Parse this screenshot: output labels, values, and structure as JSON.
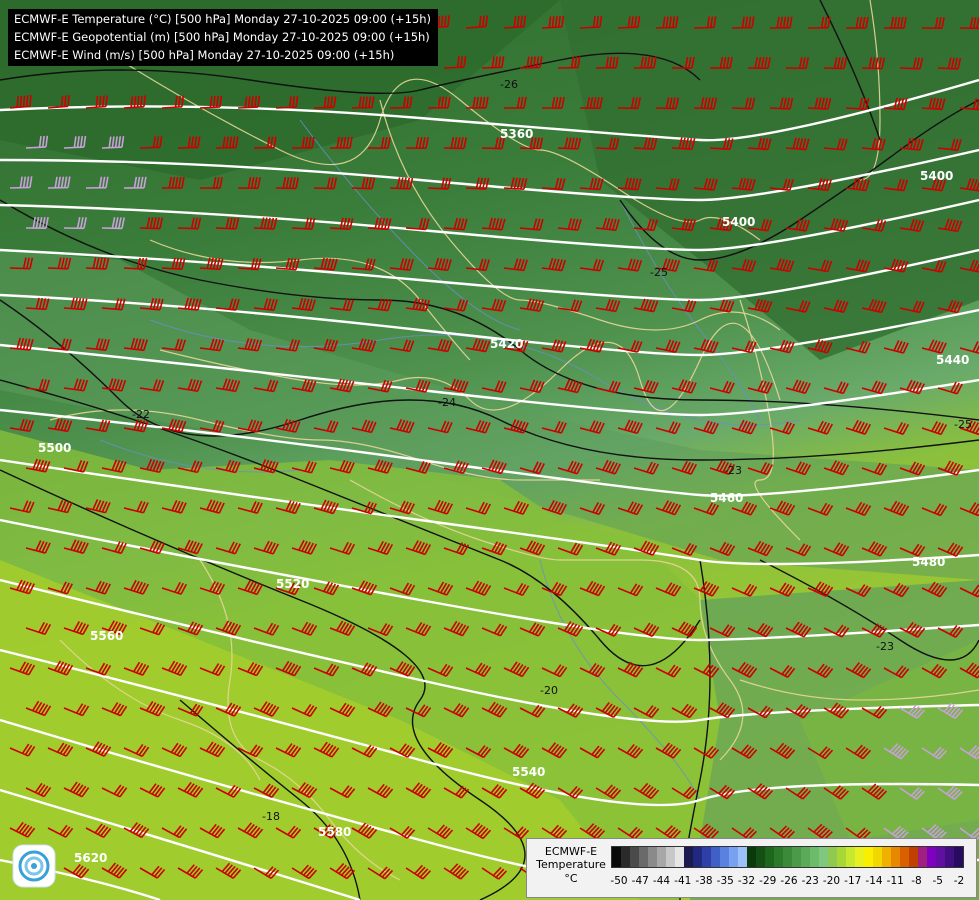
{
  "titles": [
    "ECMWF-E Temperature (°C) [500 hPa] Monday 27-10-2025 09:00 (+15h)",
    "ECMWF-E Geopotential (m) [500 hPa] Monday 27-10-2025 09:00 (+15h)",
    "ECMWF-E Wind (m/s) [500 hPa] Monday 27-10-2025 09:00 (+15h)"
  ],
  "legend": {
    "model": "ECMWF-E",
    "variable": "Temperature",
    "unit": "°C",
    "ticks": [
      "-50",
      "-47",
      "-44",
      "-41",
      "-38",
      "-35",
      "-32",
      "-29",
      "-26",
      "-23",
      "-20",
      "-17",
      "-14",
      "-11",
      "-8",
      "-5",
      "-2"
    ],
    "colors": [
      "#0a0a0a",
      "#2a2a2a",
      "#4a4a4a",
      "#6a6a6a",
      "#8a8a8a",
      "#a8a8a8",
      "#c8c8c8",
      "#e6e6e6",
      "#1a1a50",
      "#202880",
      "#2e40a8",
      "#4060c8",
      "#5a80e0",
      "#7aa0f0",
      "#9cc0f8",
      "#0a3a0a",
      "#145014",
      "#1e661e",
      "#2a7a2a",
      "#3a8a3a",
      "#4a9a4a",
      "#5aaa5a",
      "#6cba6c",
      "#80c880",
      "#90c850",
      "#a8d838",
      "#c8e830",
      "#e8f020",
      "#f8f000",
      "#f0d800",
      "#f0b000",
      "#e88800",
      "#d86000",
      "#c04000",
      "#a02080",
      "#8000c0",
      "#6010a0",
      "#401080",
      "#280a60"
    ]
  },
  "isohypse_labels": [
    "5360",
    "5400",
    "5400",
    "5420",
    "5440",
    "5460",
    "5480",
    "5500",
    "5520",
    "5540",
    "5560",
    "5580",
    "5620"
  ],
  "isotherm_labels": [
    "-26",
    "-25",
    "-24",
    "-22",
    "-23",
    "-25",
    "-23",
    "-20",
    "-18"
  ],
  "map_colors": {
    "cold": "#2f6e2f",
    "mid": "#4a8f4a",
    "light": "#6aaa6a",
    "warm": "#8ec23a",
    "warmest": "#a8d02a",
    "barb": "#cc0000",
    "barb_strong": "#c8a0d8",
    "isohypse": "#ffffff",
    "isotherm": "#111111",
    "border": "#e8d79a",
    "river": "#6a8fc8"
  },
  "icons": {
    "logo": "meteo-logo-icon"
  }
}
